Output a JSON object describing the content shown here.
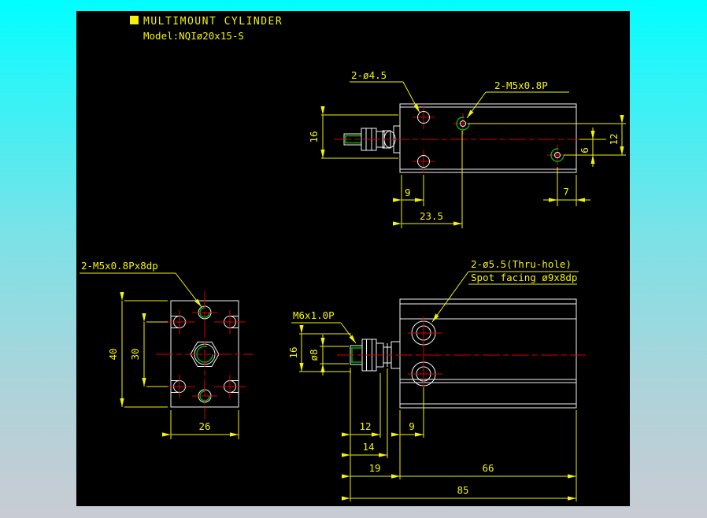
{
  "colors": {
    "background_top": "#00feff",
    "background_bottom": "#c9cbd3",
    "canvas": "#000000",
    "object_line": "#f5f5f5",
    "centerline": "#d90000",
    "dimension": "#f2f20a",
    "thread": "#00b400"
  },
  "title_block": {
    "title": "MULTIMOUNT CYLINDER",
    "model": "Model:NQIø20x15-S"
  },
  "top_view": {
    "label_holes": "2-ø4.5",
    "label_ports": "2-M5x0.8P",
    "dims": {
      "height": "16",
      "port_offset": "6",
      "port_pitch": "12",
      "hole_edge": "9",
      "port_edge": "7",
      "hole_to_port": "23.5"
    }
  },
  "front_view": {
    "label_thread_holes": "2-M5x0.8Px8dp",
    "dims": {
      "height": "40",
      "slot_pitch": "30",
      "width": "26"
    }
  },
  "side_view": {
    "label_rod_thread": "M6x1.0P",
    "label_thru_line1": "2-ø5.5(Thru-hole)",
    "label_thru_line2": "Spot facing ø9x8dp",
    "dims": {
      "rod_height": "16",
      "rod_dia": "ø8",
      "d12": "12",
      "d9": "9",
      "d14": "14",
      "d19": "19",
      "d66": "66",
      "d85": "85"
    }
  }
}
